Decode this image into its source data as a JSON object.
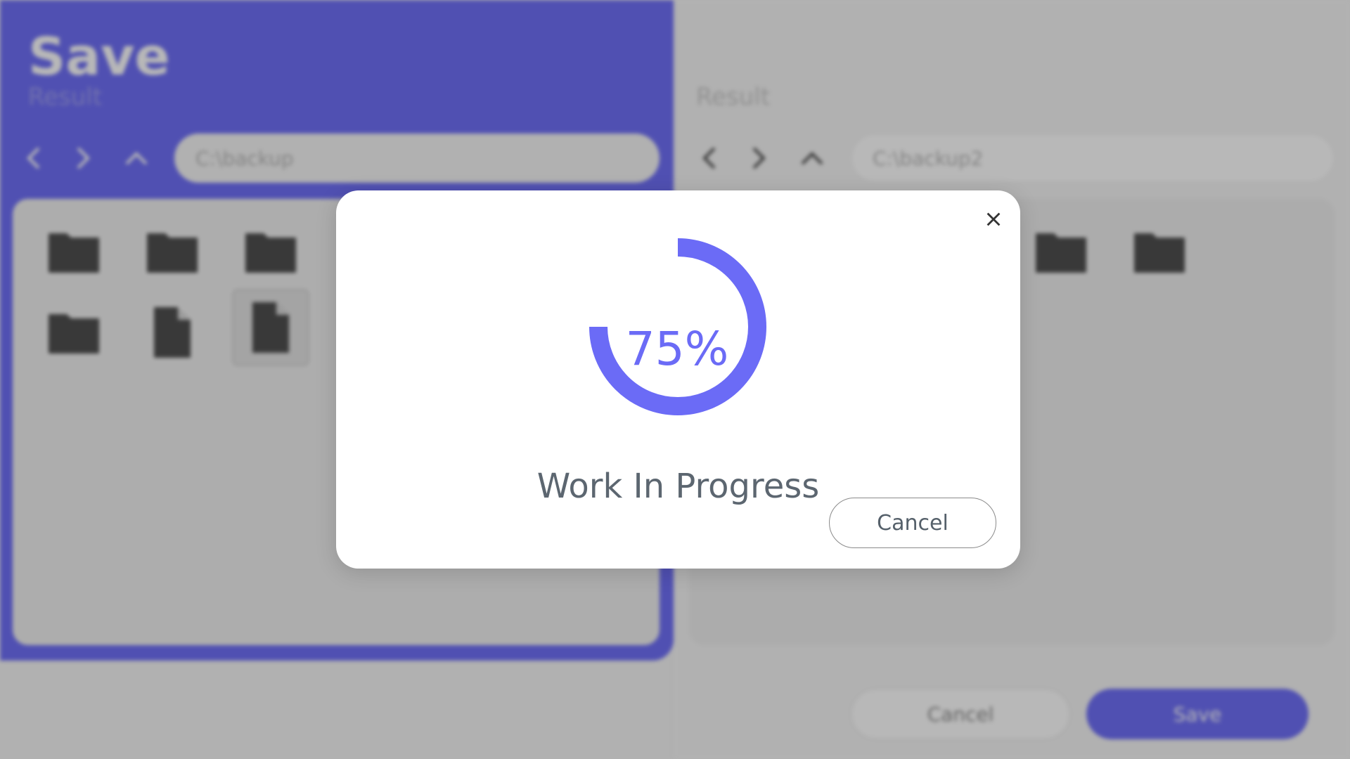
{
  "app": {
    "title": "Save",
    "left_subtitle": "Result",
    "right_subtitle": "Result"
  },
  "colors": {
    "accent": "#6b6bf6",
    "text_muted": "#5c6670",
    "icon_dark": "#4a4a4a"
  },
  "left_browser": {
    "path": "C:\\backup",
    "items": [
      {
        "type": "folder"
      },
      {
        "type": "folder"
      },
      {
        "type": "folder"
      },
      {
        "type": "folder"
      },
      {
        "type": "file"
      },
      {
        "type": "file",
        "selected": true
      }
    ]
  },
  "right_browser": {
    "path": "C:\\backup2",
    "items": [
      {
        "type": "folder"
      },
      {
        "type": "folder"
      },
      {
        "type": "folder"
      },
      {
        "type": "folder"
      },
      {
        "type": "folder"
      }
    ]
  },
  "footer": {
    "cancel_label": "Cancel",
    "save_label": "Save"
  },
  "dialog": {
    "close_icon": "close-icon",
    "progress_percent": 75,
    "percent_text": "75%",
    "status": "Work In Progress",
    "cancel_label": "Cancel"
  }
}
